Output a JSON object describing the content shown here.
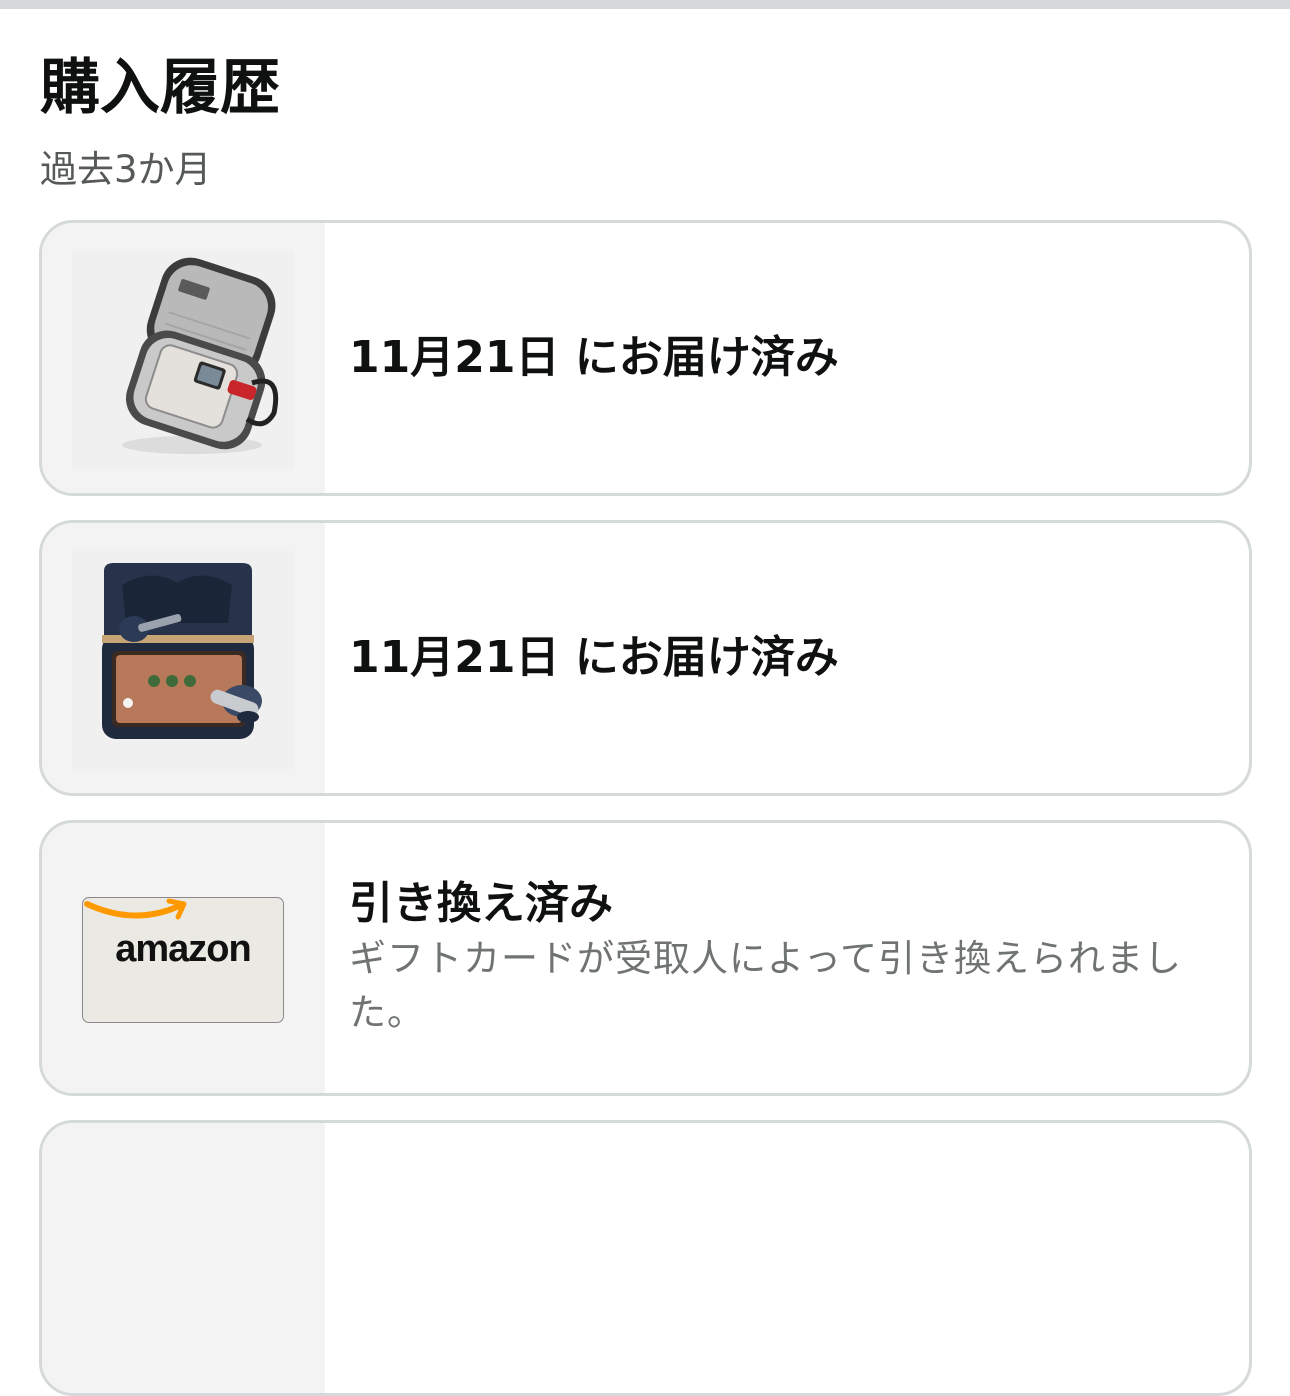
{
  "header": {
    "title": "購入履歴",
    "subtitle": "過去3か月"
  },
  "orders": [
    {
      "status": "11月21日 にお届け済み",
      "image_icon": "earbuds-carrying-case-image"
    },
    {
      "status": "11月21日 にお届け済み",
      "image_icon": "jbl-earbuds-touchscreen-case-image"
    },
    {
      "status": "引き換え済み",
      "description": "ギフトカードが受取人によって引き換えられました。",
      "image_icon": "amazon-gift-card-image",
      "gift_card_brand": "amazon"
    }
  ],
  "colors": {
    "title": "#0f1111",
    "subtitle": "#565959",
    "card_border": "#d5d9d9",
    "amazon_smile": "#ff9900"
  }
}
